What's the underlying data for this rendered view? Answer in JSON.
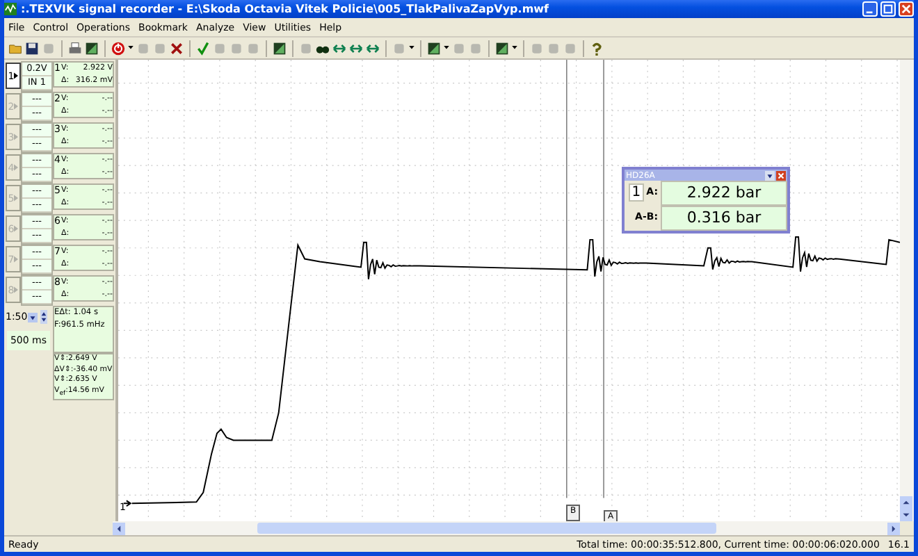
{
  "window": {
    "title": ":.TEXVIK  signal recorder - E:\\Skoda Octavia Vitek Policie\\005_TlakPalivaZapVyp.mwf"
  },
  "menu": [
    "File",
    "Control",
    "Operations",
    "Bookmark",
    "Analyze",
    "View",
    "Utilities",
    "Help"
  ],
  "channels": [
    {
      "label": "1",
      "readout_number": "1",
      "selected": true,
      "range": "0.2V",
      "input": "IN 1",
      "v_label": "V:",
      "v": "2.922 V",
      "d_label": "Δ:",
      "d": "316.2 mV"
    },
    {
      "label": "2",
      "readout_number": "2",
      "selected": false,
      "range": "---",
      "input": "---",
      "v_label": "V:",
      "v": "-.--",
      "d_label": "Δ:",
      "d": "-.--"
    },
    {
      "label": "3",
      "readout_number": "3",
      "selected": false,
      "range": "---",
      "input": "---",
      "v_label": "V:",
      "v": "-.--",
      "d_label": "Δ:",
      "d": "-.--"
    },
    {
      "label": "4",
      "readout_number": "4",
      "selected": false,
      "range": "---",
      "input": "---",
      "v_label": "V:",
      "v": "-.--",
      "d_label": "Δ:",
      "d": "-.--"
    },
    {
      "label": "5",
      "readout_number": "5",
      "selected": false,
      "range": "---",
      "input": "---",
      "v_label": "V:",
      "v": "-.--",
      "d_label": "Δ:",
      "d": "-.--"
    },
    {
      "label": "6",
      "readout_number": "6",
      "selected": false,
      "range": "---",
      "input": "---",
      "v_label": "V:",
      "v": "-.--",
      "d_label": "Δ:",
      "d": "-.--"
    },
    {
      "label": "7",
      "readout_number": "7",
      "selected": false,
      "range": "---",
      "input": "---",
      "v_label": "V:",
      "v": "-.--",
      "d_label": "Δ:",
      "d": "-.--"
    },
    {
      "label": "8",
      "readout_number": "8",
      "selected": false,
      "range": "---",
      "input": "---",
      "v_label": "V:",
      "v": "-.--",
      "d_label": "Δ:",
      "d": "-.--"
    }
  ],
  "zoom": {
    "value": "1:50",
    "timebase": "500 ms"
  },
  "measure": {
    "dt": "EΔt:  1.04 s",
    "freq": "F:961.5 mHz",
    "lines": [
      "V⇕:2.649 V",
      "ΔV⇕:-36.40 mV",
      "V⇕:2.635 V",
      "V$_{ef}$:14.56 mV"
    ]
  },
  "trace_label": "1",
  "cursors": [
    {
      "label": "B"
    },
    {
      "label": "A"
    }
  ],
  "readout": {
    "title": "HD26A",
    "channel": "1",
    "rows": [
      {
        "label": "A:",
        "value": "2.922 bar"
      },
      {
        "label": "A-B:",
        "value": "0.316 bar"
      }
    ]
  },
  "status_bar": {
    "text": "Ready",
    "time": "Total time: 00:00:35:512.800, Current time: 00:00:06:020.000",
    "version": "16.1"
  }
}
